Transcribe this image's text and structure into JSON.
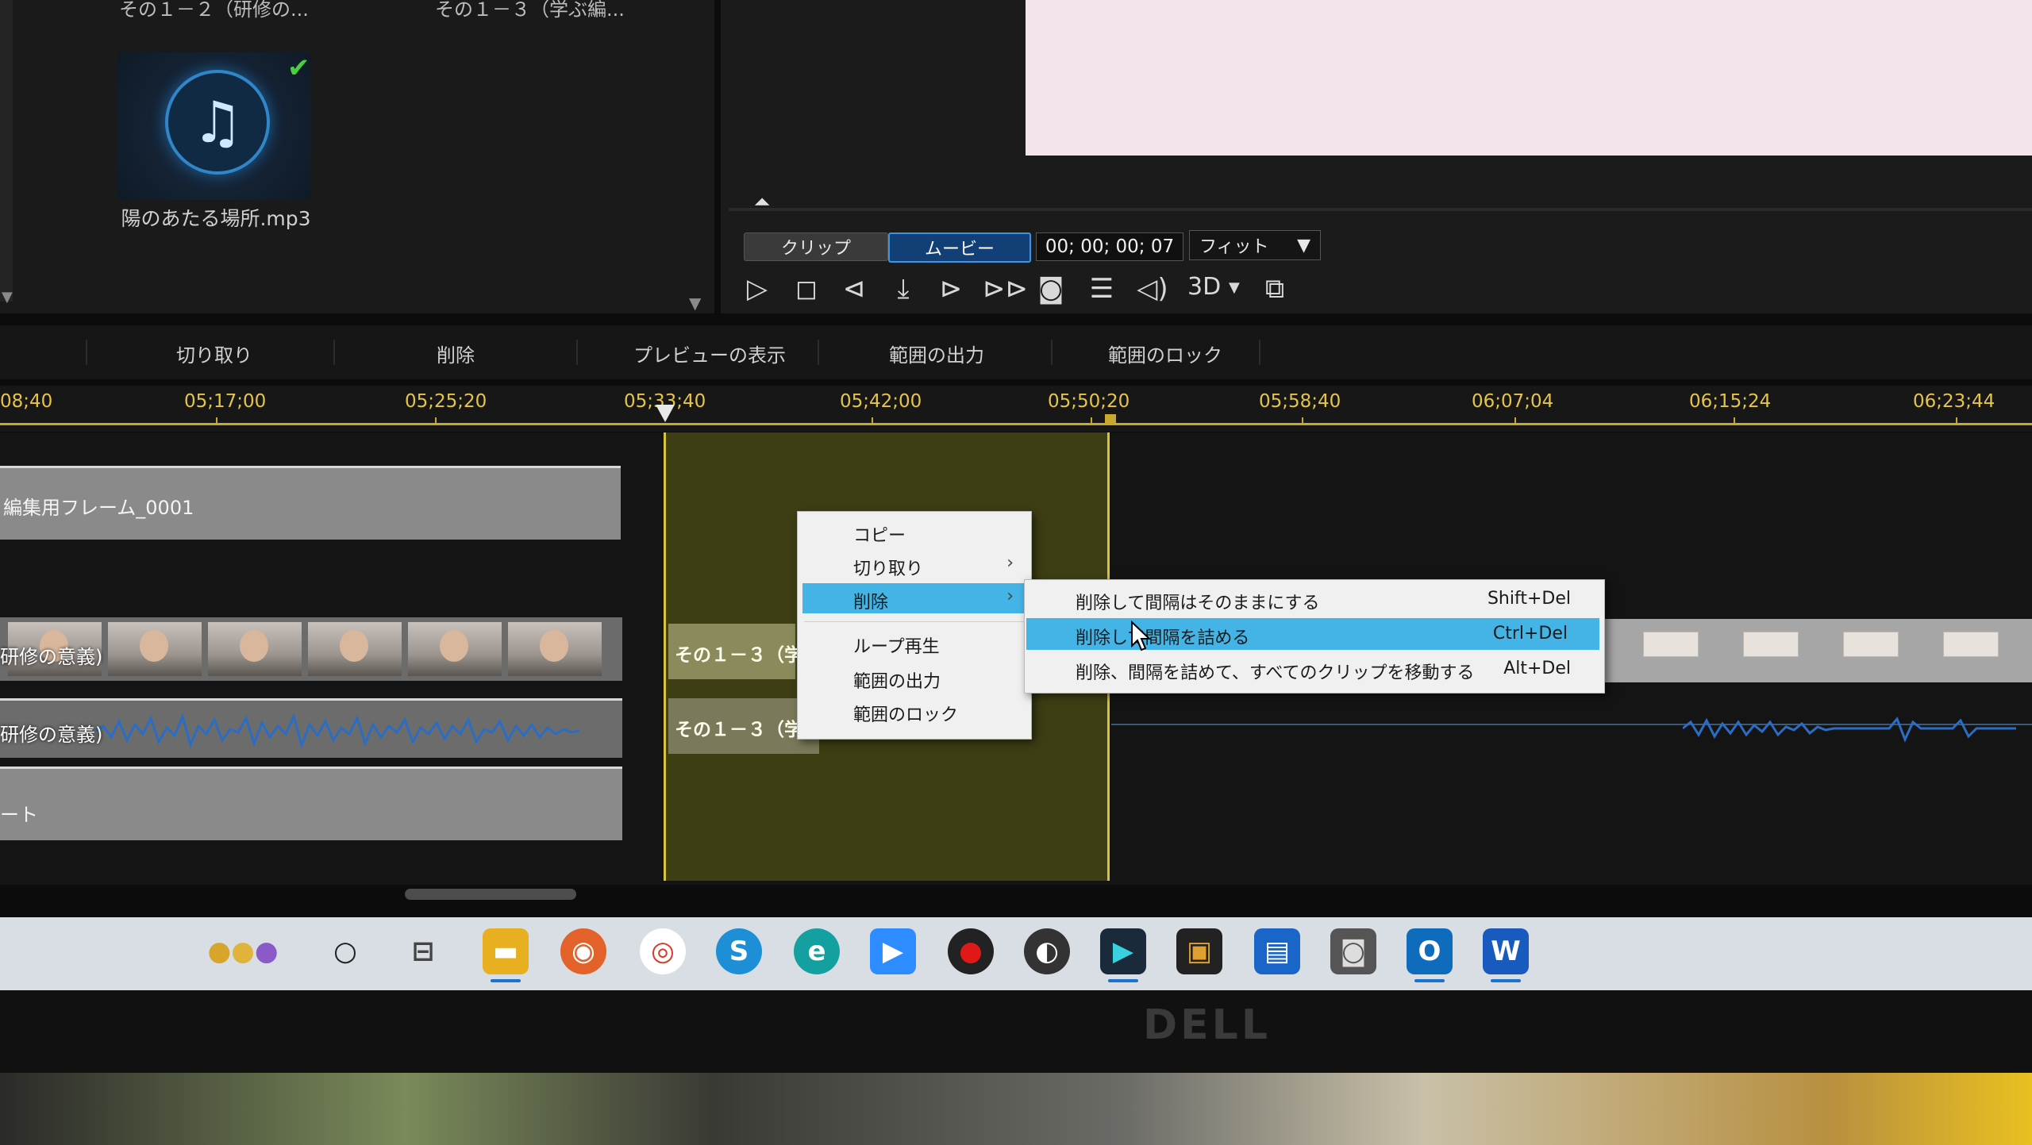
{
  "media_library": {
    "top_items": [
      "その１－２（研修の...",
      "その１－３（学ぶ編..."
    ],
    "audio_file": {
      "label": "陽のあたる場所.mp3",
      "icon": "music-note-icon",
      "checked": true
    }
  },
  "preview": {
    "mode_tabs": {
      "clip": "クリップ",
      "movie": "ムービー",
      "active": "movie"
    },
    "timecode": "00; 00; 00; 07",
    "fit_select": "フィット",
    "label_3d": "3D",
    "controls": [
      "play-icon",
      "stop-icon",
      "prev-frame-icon",
      "trim-icon",
      "next-frame-icon",
      "fast-forward-icon",
      "snapshot-icon",
      "subtitle-icon",
      "volume-icon",
      "3d-icon",
      "external-display-icon"
    ]
  },
  "toolbar": {
    "cut": "切り取り",
    "delete": "削除",
    "show_preview": "プレビューの表示",
    "export_range": "範囲の出力",
    "lock_range": "範囲のロック"
  },
  "ruler": {
    "ticks": [
      "08;40",
      "05;17;00",
      "05;25;20",
      "05;33;40",
      "05;42;00",
      "05;50;20",
      "05;58;40",
      "06;07;04",
      "06;15;24",
      "06;23;44"
    ]
  },
  "tracks": {
    "frame_clip": "編集用フレーム_0001",
    "video_clip": "研修の意義)",
    "audio_clip": "研修の意義)",
    "selected_video": "その１－３（学",
    "selected_audio": "その１－３（学",
    "third_track": "ート"
  },
  "context_menu": {
    "items": [
      {
        "label": "コピー",
        "submenu": false
      },
      {
        "label": "切り取り",
        "submenu": true
      },
      {
        "label": "削除",
        "submenu": true,
        "highlighted": true
      },
      {
        "label": "ループ再生",
        "submenu": false
      },
      {
        "label": "範囲の出力",
        "submenu": false
      },
      {
        "label": "範囲のロック",
        "submenu": false
      }
    ],
    "submenu": [
      {
        "label": "削除して間隔はそのままにする",
        "shortcut": "Shift+Del"
      },
      {
        "label": "削除して間隔を詰める",
        "shortcut": "Ctrl+Del",
        "highlighted": true
      },
      {
        "label": "削除、間隔を詰めて、すべてのクリップを移動する",
        "shortcut": "Alt+Del"
      }
    ]
  },
  "taskbar": {
    "icons": [
      "widgets-icon",
      "search-icon",
      "task-view-icon",
      "file-explorer-icon",
      "firefox-icon",
      "chrome-icon",
      "skype-icon",
      "edge-icon",
      "zoom-icon",
      "record-icon",
      "obs-icon",
      "powerdirector-icon",
      "photo-app-icon",
      "movie-app-icon",
      "camera-icon",
      "outlook-icon",
      "word-icon"
    ]
  },
  "monitor": {
    "brand": "DELL"
  },
  "colors": {
    "accent": "#44b4e6",
    "range": "#d8c43a",
    "timecode": "#e6c44a"
  }
}
